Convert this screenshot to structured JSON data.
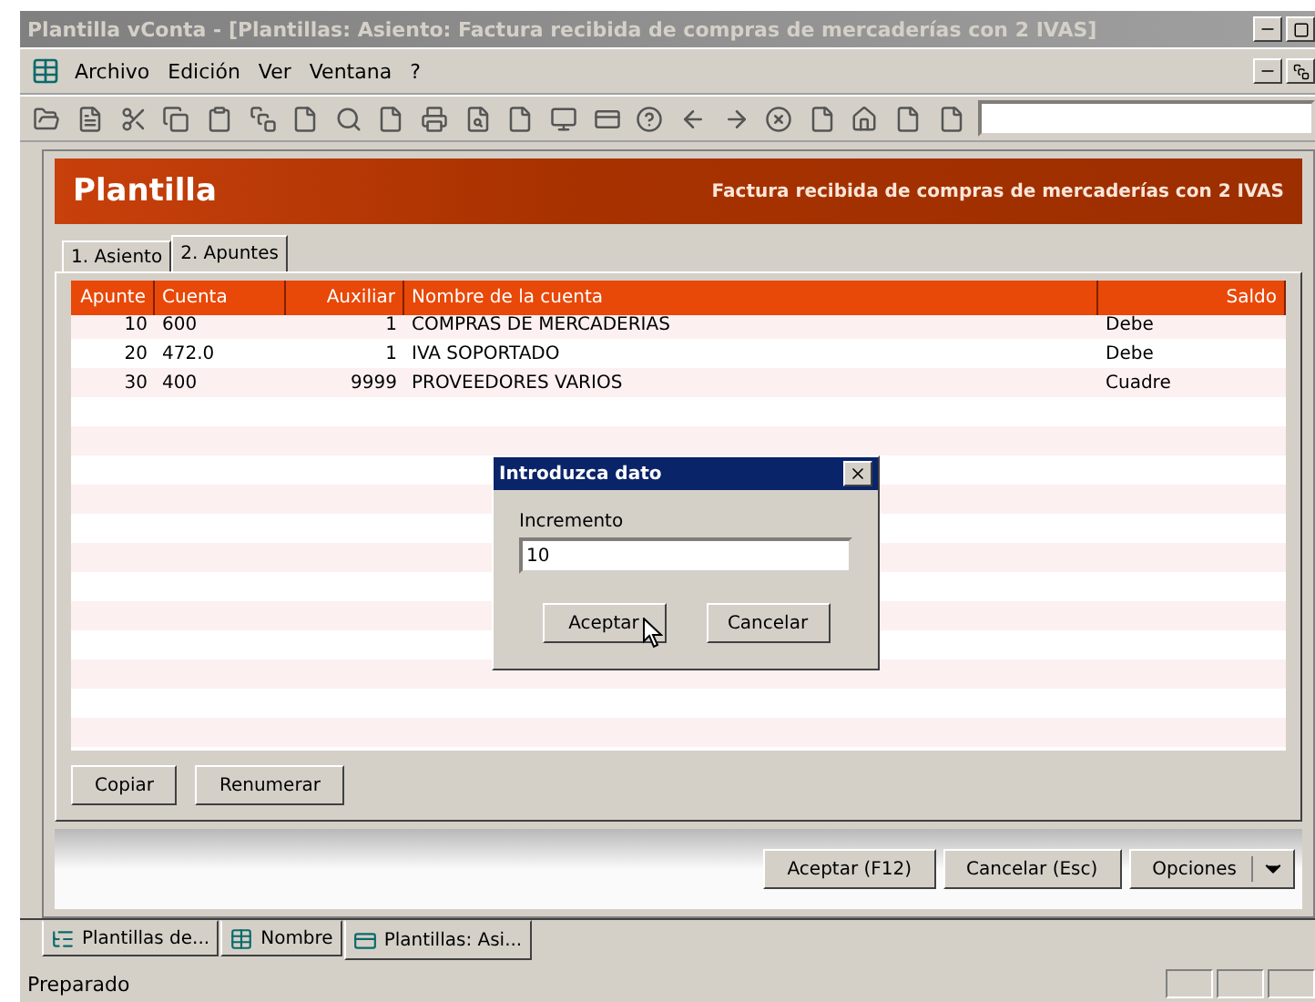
{
  "window": {
    "title": "Plantilla vConta - [Plantillas: Asiento: Factura recibida de compras de mercaderías con 2 IVAS]"
  },
  "menu": [
    "Archivo",
    "Edición",
    "Ver",
    "Ventana",
    "?"
  ],
  "header": {
    "title": "Plantilla",
    "subtitle": "Factura recibida de compras de mercaderías con 2 IVAS"
  },
  "tabs": [
    {
      "label": "1. Asiento",
      "selected": false
    },
    {
      "label": "2. Apuntes",
      "selected": true
    }
  ],
  "table": {
    "columns": [
      "Apunte",
      "Cuenta",
      "Auxiliar",
      "Nombre de la cuenta",
      "Saldo"
    ],
    "rows": [
      [
        "10",
        "600",
        "1",
        "COMPRAS DE MERCADERIAS",
        "Debe"
      ],
      [
        "20",
        "472.0",
        "1",
        "IVA SOPORTADO",
        "Debe"
      ],
      [
        "30",
        "400",
        "9999",
        "PROVEEDORES VARIOS",
        "Cuadre"
      ]
    ]
  },
  "table_buttons": [
    "Copiar",
    "Renumerar"
  ],
  "footer_buttons": [
    "Aceptar (F12)",
    "Cancelar (Esc)",
    "Opciones"
  ],
  "dialog": {
    "title": "Introduzca dato",
    "label": "Incremento",
    "value": "10",
    "buttons": [
      "Aceptar",
      "Cancelar"
    ]
  },
  "window_tabs": [
    {
      "label": "Plantillas de...",
      "selected": false
    },
    {
      "label": "Nombre",
      "selected": false
    },
    {
      "label": "Plantillas: Asi...",
      "selected": true
    }
  ],
  "status_bar": "Preparado"
}
